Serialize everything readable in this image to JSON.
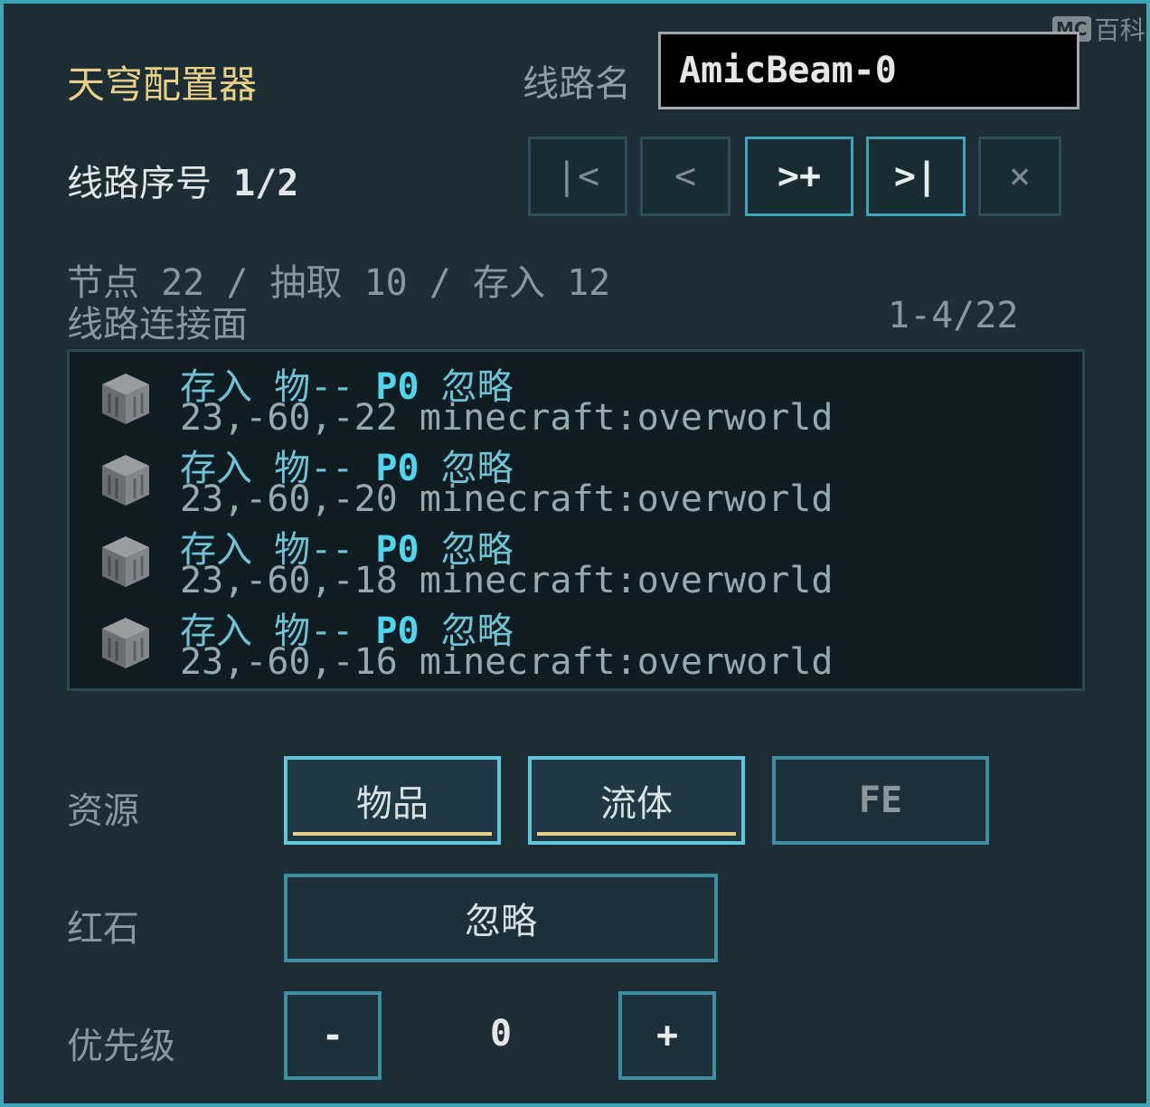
{
  "header": {
    "title": "天穹配置器",
    "name_label": "线路名",
    "name_value": "AmicBeam-0"
  },
  "route": {
    "label": "线路序号",
    "value": "1/2"
  },
  "nav": {
    "first": "|<",
    "prev": "<",
    "next_add": ">+",
    "last": ">|",
    "delete": "×"
  },
  "stats": {
    "text": "节点 22 / 抽取 10 / 存入 12"
  },
  "faces": {
    "label": "线路连接面",
    "count": "1-4/22"
  },
  "list": [
    {
      "mode": "存入",
      "type": "物--",
      "p": "P0",
      "redstone": "忽略",
      "coords": "23,-60,-22 minecraft:overworld",
      "icon": "stone-block-icon"
    },
    {
      "mode": "存入",
      "type": "物--",
      "p": "P0",
      "redstone": "忽略",
      "coords": "23,-60,-20 minecraft:overworld",
      "icon": "stone-block-icon"
    },
    {
      "mode": "存入",
      "type": "物--",
      "p": "P0",
      "redstone": "忽略",
      "coords": "23,-60,-18 minecraft:overworld",
      "icon": "stone-block-icon"
    },
    {
      "mode": "存入",
      "type": "物--",
      "p": "P0",
      "redstone": "忽略",
      "coords": "23,-60,-16 minecraft:overworld",
      "icon": "stone-block-icon"
    }
  ],
  "resources": {
    "label": "资源",
    "items": "物品",
    "fluid": "流体",
    "fe": "FE"
  },
  "redstone": {
    "label": "红石",
    "value": "忽略"
  },
  "priority": {
    "label": "优先级",
    "minus": "-",
    "value": "0",
    "plus": "+"
  },
  "watermark": {
    "badge": "MC",
    "text": "百科"
  },
  "colors": {
    "accent": "#41a3b6",
    "title": "#e8cf86",
    "background": "#1c2d35"
  }
}
